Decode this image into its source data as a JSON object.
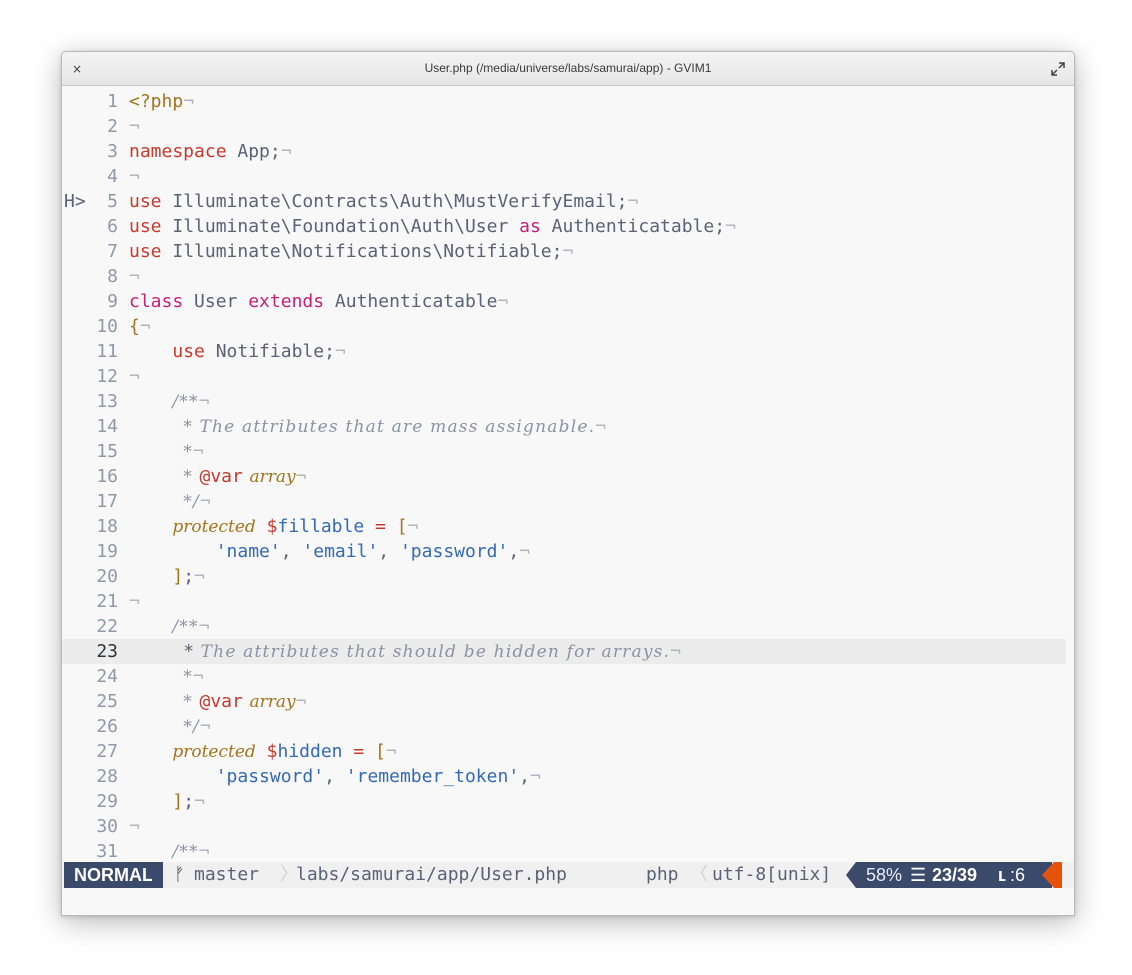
{
  "window": {
    "title": "User.php (/media/universe/labs/samurai/app) - GVIM1",
    "close_glyph": "×"
  },
  "editor": {
    "current_line": 23,
    "cursor_char": "*",
    "lines": [
      {
        "n": "1",
        "sign": "",
        "segs": [
          [
            "php",
            "<?php"
          ],
          [
            "nl",
            "¬"
          ]
        ]
      },
      {
        "n": "2",
        "sign": "",
        "segs": [
          [
            "nl",
            "¬"
          ]
        ]
      },
      {
        "n": "3",
        "sign": "",
        "segs": [
          [
            "kw",
            "namespace"
          ],
          [
            "id",
            " App;"
          ],
          [
            "nl",
            "¬"
          ]
        ]
      },
      {
        "n": "4",
        "sign": "",
        "segs": [
          [
            "nl",
            "¬"
          ]
        ]
      },
      {
        "n": "5",
        "sign": "H>",
        "segs": [
          [
            "kw",
            "use"
          ],
          [
            "id",
            " Illuminate\\Contracts\\Auth\\MustVerifyEmail;"
          ],
          [
            "nl",
            "¬"
          ]
        ]
      },
      {
        "n": "6",
        "sign": "",
        "segs": [
          [
            "kw",
            "use"
          ],
          [
            "id",
            " Illuminate\\Foundation\\Auth\\User "
          ],
          [
            "kw2",
            "as"
          ],
          [
            "id",
            " Authenticatable;"
          ],
          [
            "nl",
            "¬"
          ]
        ]
      },
      {
        "n": "7",
        "sign": "",
        "segs": [
          [
            "kw",
            "use"
          ],
          [
            "id",
            " Illuminate\\Notifications\\Notifiable;"
          ],
          [
            "nl",
            "¬"
          ]
        ]
      },
      {
        "n": "8",
        "sign": "",
        "segs": [
          [
            "nl",
            "¬"
          ]
        ]
      },
      {
        "n": "9",
        "sign": "",
        "segs": [
          [
            "kw2",
            "class"
          ],
          [
            "id",
            " User "
          ],
          [
            "kw2",
            "extends"
          ],
          [
            "id",
            " Authenticatable"
          ],
          [
            "nl",
            "¬"
          ]
        ]
      },
      {
        "n": "10",
        "sign": "",
        "segs": [
          [
            "punc",
            "{"
          ],
          [
            "nl",
            "¬"
          ]
        ]
      },
      {
        "n": "11",
        "sign": "",
        "segs": [
          [
            "id",
            "    "
          ],
          [
            "kw",
            "use"
          ],
          [
            "id",
            " Notifiable;"
          ],
          [
            "nl",
            "¬"
          ]
        ]
      },
      {
        "n": "12",
        "sign": "",
        "segs": [
          [
            "nl",
            "¬"
          ]
        ]
      },
      {
        "n": "13",
        "sign": "",
        "segs": [
          [
            "id",
            "    "
          ],
          [
            "cm",
            "/**"
          ],
          [
            "nl",
            "¬"
          ]
        ]
      },
      {
        "n": "14",
        "sign": "",
        "segs": [
          [
            "id",
            "     "
          ],
          [
            "cm",
            "* The attributes that are mass assignable."
          ],
          [
            "nl",
            "¬"
          ]
        ]
      },
      {
        "n": "15",
        "sign": "",
        "segs": [
          [
            "id",
            "     "
          ],
          [
            "cm",
            "*"
          ],
          [
            "nl",
            "¬"
          ]
        ]
      },
      {
        "n": "16",
        "sign": "",
        "segs": [
          [
            "id",
            "     "
          ],
          [
            "cm",
            "* "
          ],
          [
            "tag",
            "@var"
          ],
          [
            "cm",
            " "
          ],
          [
            "type",
            "array"
          ],
          [
            "nl",
            "¬"
          ]
        ]
      },
      {
        "n": "17",
        "sign": "",
        "segs": [
          [
            "id",
            "     "
          ],
          [
            "cm",
            "*/"
          ],
          [
            "nl",
            "¬"
          ]
        ]
      },
      {
        "n": "18",
        "sign": "",
        "segs": [
          [
            "id",
            "    "
          ],
          [
            "type",
            "protected"
          ],
          [
            "id",
            " "
          ],
          [
            "var",
            "$"
          ],
          [
            "str",
            "fillable"
          ],
          [
            "id",
            " "
          ],
          [
            "kw",
            "="
          ],
          [
            "id",
            " "
          ],
          [
            "punc",
            "["
          ],
          [
            "nl",
            "¬"
          ]
        ]
      },
      {
        "n": "19",
        "sign": "",
        "segs": [
          [
            "id",
            "        "
          ],
          [
            "str",
            "'name'"
          ],
          [
            "id",
            ", "
          ],
          [
            "str",
            "'email'"
          ],
          [
            "id",
            ", "
          ],
          [
            "str",
            "'password'"
          ],
          [
            "id",
            ","
          ],
          [
            "nl",
            "¬"
          ]
        ]
      },
      {
        "n": "20",
        "sign": "",
        "segs": [
          [
            "id",
            "    "
          ],
          [
            "punc",
            "]"
          ],
          [
            "id",
            ";"
          ],
          [
            "nl",
            "¬"
          ]
        ]
      },
      {
        "n": "21",
        "sign": "",
        "segs": [
          [
            "nl",
            "¬"
          ]
        ]
      },
      {
        "n": "22",
        "sign": "",
        "segs": [
          [
            "id",
            "    "
          ],
          [
            "cm",
            "/**"
          ],
          [
            "nl",
            "¬"
          ]
        ]
      },
      {
        "n": "23",
        "sign": "",
        "segs": [
          [
            "id",
            "     "
          ],
          [
            "cursor",
            "*"
          ],
          [
            "cm",
            " The attributes that should be hidden for arrays."
          ],
          [
            "nl",
            "¬"
          ]
        ]
      },
      {
        "n": "24",
        "sign": "",
        "segs": [
          [
            "id",
            "     "
          ],
          [
            "cm",
            "*"
          ],
          [
            "nl",
            "¬"
          ]
        ]
      },
      {
        "n": "25",
        "sign": "",
        "segs": [
          [
            "id",
            "     "
          ],
          [
            "cm",
            "* "
          ],
          [
            "tag",
            "@var"
          ],
          [
            "cm",
            " "
          ],
          [
            "type",
            "array"
          ],
          [
            "nl",
            "¬"
          ]
        ]
      },
      {
        "n": "26",
        "sign": "",
        "segs": [
          [
            "id",
            "     "
          ],
          [
            "cm",
            "*/"
          ],
          [
            "nl",
            "¬"
          ]
        ]
      },
      {
        "n": "27",
        "sign": "",
        "segs": [
          [
            "id",
            "    "
          ],
          [
            "type",
            "protected"
          ],
          [
            "id",
            " "
          ],
          [
            "var",
            "$"
          ],
          [
            "str",
            "hidden"
          ],
          [
            "id",
            " "
          ],
          [
            "kw",
            "="
          ],
          [
            "id",
            " "
          ],
          [
            "punc",
            "["
          ],
          [
            "nl",
            "¬"
          ]
        ]
      },
      {
        "n": "28",
        "sign": "",
        "segs": [
          [
            "id",
            "        "
          ],
          [
            "str",
            "'password'"
          ],
          [
            "id",
            ", "
          ],
          [
            "str",
            "'remember_token'"
          ],
          [
            "id",
            ","
          ],
          [
            "nl",
            "¬"
          ]
        ]
      },
      {
        "n": "29",
        "sign": "",
        "segs": [
          [
            "id",
            "    "
          ],
          [
            "punc",
            "]"
          ],
          [
            "id",
            ";"
          ],
          [
            "nl",
            "¬"
          ]
        ]
      },
      {
        "n": "30",
        "sign": "",
        "segs": [
          [
            "nl",
            "¬"
          ]
        ]
      },
      {
        "n": "31",
        "sign": "",
        "segs": [
          [
            "id",
            "    "
          ],
          [
            "cm",
            "/**"
          ],
          [
            "nl",
            "¬"
          ]
        ]
      }
    ]
  },
  "statusline": {
    "mode": "NORMAL",
    "branch_icon": "ᚠ",
    "branch": "master",
    "separator": "〉",
    "filepath": "labs/samurai/app/User.php",
    "filetype": "php",
    "encoding": "utf-8[unix]",
    "percent": "58%",
    "lines_icon": "☰",
    "line_pos": "23/39",
    "col_icon": "␤",
    "col": ":6"
  },
  "colors": {
    "accent": "#3b4a6b",
    "warning": "#e5530d",
    "keyword": "#c8392d",
    "keyword2": "#c2207a",
    "string": "#3469b3",
    "php_tag": "#a2741c",
    "comment": "#8993a4"
  }
}
